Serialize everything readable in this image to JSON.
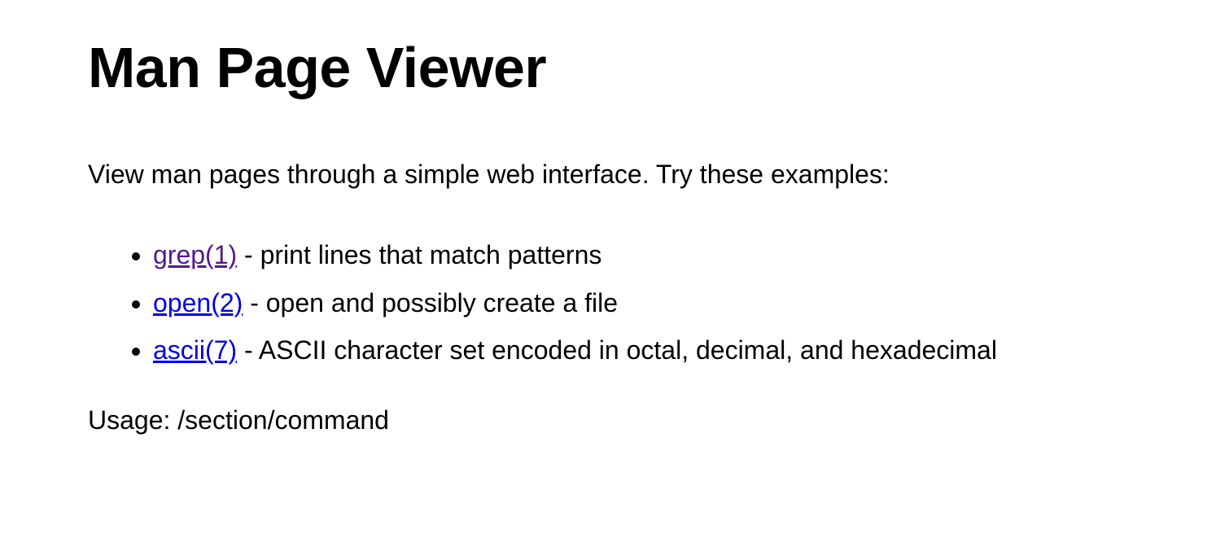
{
  "page": {
    "title": "Man Page Viewer",
    "intro": "View man pages through a simple web interface. Try these examples:",
    "examples": [
      {
        "link_text": "grep(1)",
        "description": " - print lines that match patterns",
        "state": "visited"
      },
      {
        "link_text": "open(2)",
        "description": " - open and possibly create a file",
        "state": "unvisited"
      },
      {
        "link_text": "ascii(7)",
        "description": " - ASCII character set encoded in octal, decimal, and hexadecimal",
        "state": "unvisited"
      }
    ],
    "usage": "Usage: /section/command"
  },
  "colors": {
    "link": "#0000ee",
    "visited_link": "#551a8b",
    "text": "#000000",
    "background": "#ffffff"
  }
}
